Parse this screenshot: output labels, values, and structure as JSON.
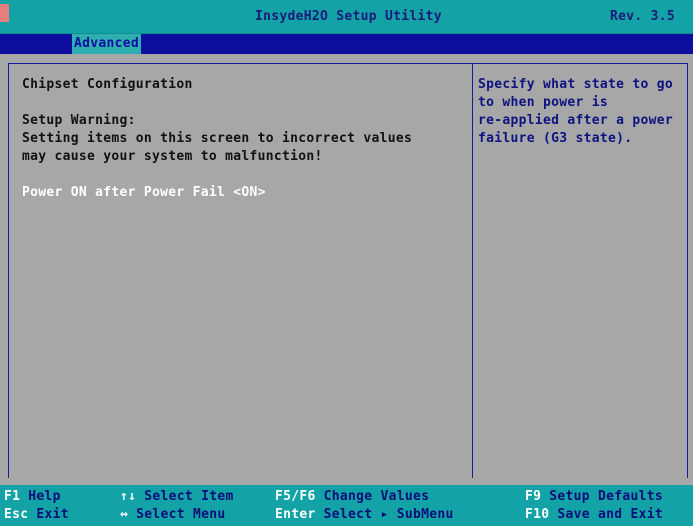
{
  "header": {
    "title": "InsydeH2O Setup Utility",
    "revision": "Rev. 3.5"
  },
  "menubar": {
    "tabs": [
      {
        "label": "Advanced",
        "selected": true
      }
    ]
  },
  "main": {
    "page_title": "Chipset Configuration",
    "warning_heading": "Setup Warning:",
    "warning_lines": [
      "Setting items on this screen to incorrect values",
      "may cause your system to malfunction!"
    ],
    "item": {
      "label": "Power ON after Power Fail",
      "value": "<ON>",
      "text": "Power ON after Power Fail <ON>"
    }
  },
  "help": {
    "lines": [
      "Specify what state to go",
      "to when power is",
      "re-applied after a power",
      "failure (G3 state)."
    ]
  },
  "footer": {
    "f1": {
      "key": "F1",
      "desc": "Help"
    },
    "esc": {
      "key": "Esc",
      "desc": "Exit"
    },
    "select_item": {
      "glyph": "↑↓",
      "desc": "Select Item"
    },
    "select_menu": {
      "glyph": "↔",
      "desc": "Select Menu"
    },
    "change_values": {
      "key": "F5/F6",
      "desc": "Change Values"
    },
    "enter": {
      "key": "Enter",
      "desc": "Select ▸ SubMenu"
    },
    "f9": {
      "key": "F9",
      "desc": "Setup Defaults"
    },
    "f10": {
      "key": "F10",
      "desc": "Save and Exit"
    }
  },
  "colors": {
    "title_bar": "#13a3a6",
    "menu_bar": "#0d0d9e",
    "body": "#a7a7a7",
    "help_text": "#0d1280",
    "selected_item": "#ffffff"
  }
}
